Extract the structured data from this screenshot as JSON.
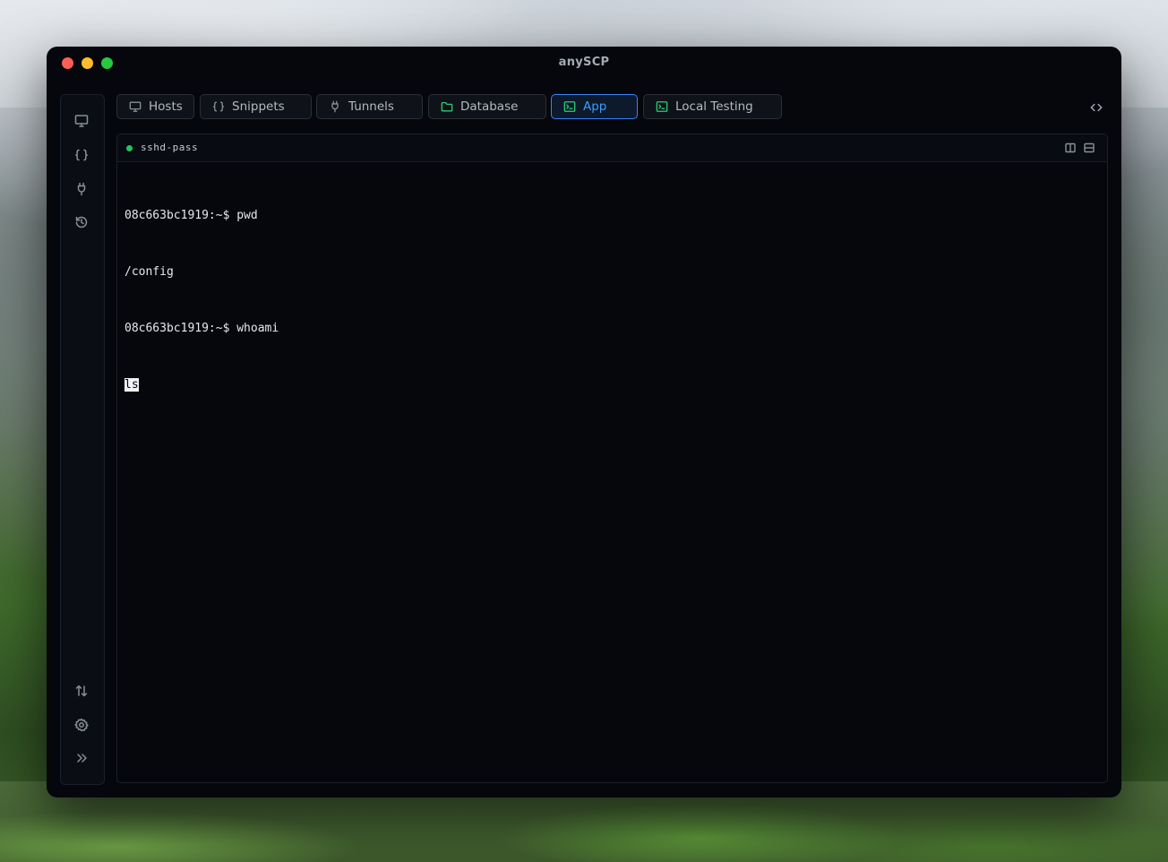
{
  "app": {
    "title": "anySCP"
  },
  "sidebar": {
    "items": [
      {
        "icon": "monitor-icon",
        "label": "Hosts"
      },
      {
        "icon": "braces-icon",
        "label": "Snippets"
      },
      {
        "icon": "plug-icon",
        "label": "Tunnels"
      },
      {
        "icon": "history-icon",
        "label": "History"
      }
    ],
    "bottom_items": [
      {
        "icon": "transfer-arrows-icon",
        "label": "Transfers"
      },
      {
        "icon": "gear-icon",
        "label": "Settings"
      },
      {
        "icon": "chevrons-right-icon",
        "label": "Expand"
      }
    ]
  },
  "tabs": [
    {
      "label": "Hosts",
      "icon": "monitor-icon",
      "active": false
    },
    {
      "label": "Snippets",
      "icon": "braces-icon",
      "active": false
    },
    {
      "label": "Tunnels",
      "icon": "plug-icon",
      "active": false
    },
    {
      "label": "Database",
      "icon": "folder-icon",
      "active": false
    },
    {
      "label": "App",
      "icon": "terminal-icon",
      "active": true
    },
    {
      "label": "Local Testing",
      "icon": "terminal-icon",
      "active": false
    }
  ],
  "terminal": {
    "session_name": "sshd-pass",
    "status_color": "#22c55e",
    "lines": [
      "08c663bc1919:~$ pwd",
      "/config",
      "08c663bc1919:~$ whoami"
    ],
    "current_input": "ls"
  },
  "colors": {
    "accent": "#3b82f6",
    "active_text": "#3b9cff",
    "status_green": "#22c55e",
    "background": "#05070c"
  }
}
